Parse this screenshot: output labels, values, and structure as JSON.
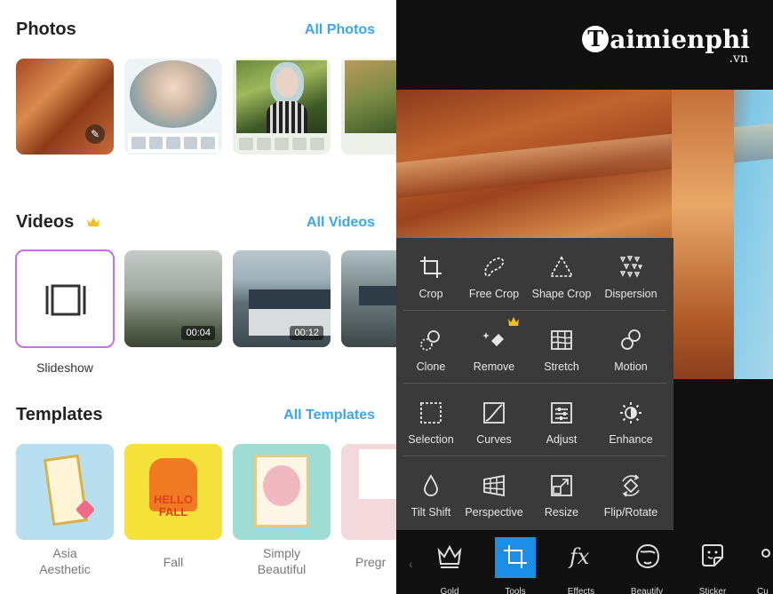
{
  "photos": {
    "title": "Photos",
    "link": "All Photos"
  },
  "videos": {
    "title": "Videos",
    "link": "All Videos",
    "slideshow_label": "Slideshow",
    "durations": [
      "00:04",
      "00:12"
    ]
  },
  "templates": {
    "title": "Templates",
    "link": "All Templates",
    "items": [
      {
        "label": "Asia\nAesthetic"
      },
      {
        "label": "Fall"
      },
      {
        "label": "Simply\nBeautiful"
      },
      {
        "label": "Pregr"
      }
    ],
    "hello_fall": "HELLO\nFALL"
  },
  "brand": {
    "name": "aimienphi",
    "letter": "T",
    "tld": ".vn"
  },
  "tools": [
    {
      "label": "Crop",
      "icon": "crop-icon"
    },
    {
      "label": "Free Crop",
      "icon": "free-crop-icon"
    },
    {
      "label": "Shape Crop",
      "icon": "shape-crop-icon"
    },
    {
      "label": "Dispersion",
      "icon": "dispersion-icon"
    },
    {
      "label": "Clone",
      "icon": "clone-icon"
    },
    {
      "label": "Remove",
      "icon": "remove-icon",
      "premium": true
    },
    {
      "label": "Stretch",
      "icon": "stretch-icon"
    },
    {
      "label": "Motion",
      "icon": "motion-icon"
    },
    {
      "label": "Selection",
      "icon": "selection-icon"
    },
    {
      "label": "Curves",
      "icon": "curves-icon"
    },
    {
      "label": "Adjust",
      "icon": "adjust-icon"
    },
    {
      "label": "Enhance",
      "icon": "enhance-icon"
    },
    {
      "label": "Tilt Shift",
      "icon": "tilt-shift-icon"
    },
    {
      "label": "Perspective",
      "icon": "perspective-icon"
    },
    {
      "label": "Resize",
      "icon": "resize-icon"
    },
    {
      "label": "Flip/Rotate",
      "icon": "flip-rotate-icon"
    }
  ],
  "bottom_nav": [
    {
      "label": "Gold",
      "icon": "crown-icon"
    },
    {
      "label": "Tools",
      "icon": "crop-icon",
      "active": true
    },
    {
      "label": "Effects",
      "icon": "fx-icon"
    },
    {
      "label": "Beautify",
      "icon": "beautify-icon"
    },
    {
      "label": "Sticker",
      "icon": "sticker-icon"
    },
    {
      "label": "Cu",
      "icon": "cutout-icon"
    }
  ],
  "colors": {
    "accent_blue": "#3aa6f0",
    "active_tab": "#1b8fe8",
    "slideshow_border": "#c66ef0",
    "crown_gold": "#f2c21a"
  }
}
